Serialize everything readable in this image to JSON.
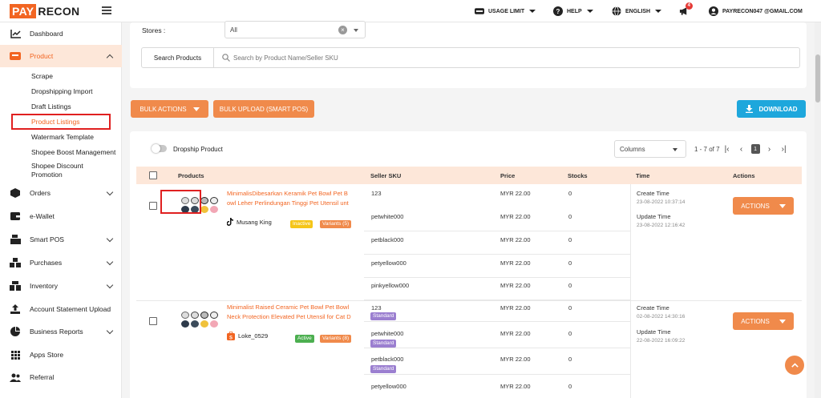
{
  "topbar": {
    "logo_pay": "PAY",
    "logo_recon": "RECON",
    "usage_limit": "USAGE LIMIT",
    "help": "HELP",
    "language": "ENGLISH",
    "notification_count": "4",
    "user_email": "PAYRECON047 @GMAIL.COM"
  },
  "sidebar": {
    "dashboard": "Dashboard",
    "product": "Product",
    "sub": {
      "scrape": "Scrape",
      "dropshipping_import": "Dropshipping Import",
      "draft_listings": "Draft Listings",
      "product_listings": "Product Listings",
      "watermark_template": "Watermark Template",
      "shopee_boost": "Shopee Boost Management",
      "shopee_discount_1": "Shopee Discount",
      "shopee_discount_2": "Promotion"
    },
    "orders": "Orders",
    "ewallet": "e-Wallet",
    "smart_pos": "Smart POS",
    "purchases": "Purchases",
    "inventory": "Inventory",
    "account_statement": "Account Statement Upload",
    "business_reports": "Business Reports",
    "apps_store": "Apps Store",
    "referral": "Referral"
  },
  "filters": {
    "stores_label": "Stores :",
    "stores_value": "All",
    "search_label": "Search Products",
    "search_placeholder": "Search by Product Name/Seller SKU"
  },
  "toolbar": {
    "bulk_actions": "BULK ACTIONS",
    "bulk_upload": "BULK UPLOAD (SMART POS)",
    "download": "DOWNLOAD",
    "dropship_toggle": "Dropship Product",
    "columns": "Columns",
    "range": "1 - 7 of 7",
    "current_page": "1"
  },
  "table": {
    "headers": {
      "products": "Products",
      "seller_sku": "Seller SKU",
      "price": "Price",
      "stocks": "Stocks",
      "time": "Time",
      "actions": "Actions"
    },
    "rows": [
      {
        "name_line1": "MinimalisDibesarkan Keramik Pet Bowl Pet B",
        "name_line2": "owl Leher Perlindungan Tinggi Pet Utensil unt",
        "shop": "Musang King",
        "status": "Inactive",
        "variants": "Variants (5)",
        "skus": [
          "123",
          "petwhite000",
          "petblack000",
          "petyellow000",
          "pinkyellow000"
        ],
        "prices": [
          "MYR 22.00",
          "MYR 22.00",
          "MYR 22.00",
          "MYR 22.00",
          "MYR 22.00"
        ],
        "stocks": [
          "0",
          "0",
          "0",
          "0",
          "0"
        ],
        "create_label": "Create Time",
        "create_time": "23-08-2022 10:37:14",
        "update_label": "Update Time",
        "update_time": "23-08-2022 12:16:42",
        "actions": "ACTIONS"
      },
      {
        "name_line1": "Minimalist Raised Ceramic Pet Bowl Pet Bowl",
        "name_line2": "Neck Protection Elevated Pet Utensil for Cat D",
        "shop": "Loke_0529",
        "status": "Active",
        "variants": "Variants (8)",
        "skus": [
          "123",
          "petwhite000",
          "petblack000",
          "petyellow000"
        ],
        "sku_tag": "Standard",
        "prices": [
          "MYR 22.00",
          "MYR 22.00",
          "MYR 22.00",
          "MYR 22.00"
        ],
        "stocks": [
          "0",
          "0",
          "0",
          "0"
        ],
        "create_label": "Create Time",
        "create_time": "02-08-2022 14:30:16",
        "update_label": "Update Time",
        "update_time": "22-08-2022 16:09:22",
        "actions": "ACTIONS"
      }
    ]
  }
}
